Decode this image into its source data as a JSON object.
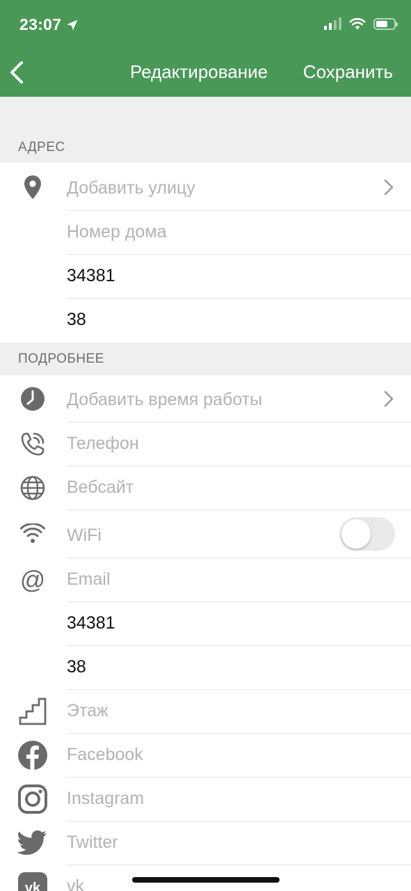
{
  "status": {
    "time": "23:07"
  },
  "nav": {
    "title": "Редактирование",
    "save": "Сохранить"
  },
  "address": {
    "section_label": "АДРЕС",
    "street_placeholder": "Добавить улицу",
    "house_placeholder": "Номер дома",
    "value1": "34381",
    "value2": "38"
  },
  "details": {
    "section_label": "ПОДРОБНЕЕ",
    "hours_placeholder": "Добавить время работы",
    "phone_placeholder": "Телефон",
    "website_placeholder": "Вебсайт",
    "wifi_label": "WiFi",
    "wifi_on": false,
    "email_placeholder": "Email",
    "value1": "34381",
    "value2": "38",
    "floor_placeholder": "Этаж",
    "facebook_placeholder": "Facebook",
    "instagram_placeholder": "Instagram",
    "twitter_placeholder": "Twitter",
    "vk_placeholder": "vk"
  },
  "colors": {
    "header": "#4a9858",
    "icon": "#6a6a6a",
    "placeholder": "#b3b3b3"
  }
}
